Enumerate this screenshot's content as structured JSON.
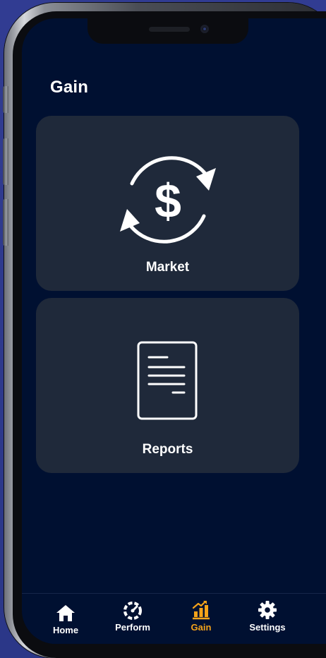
{
  "header": {
    "title": "Gain"
  },
  "cards": {
    "market": {
      "label": "Market",
      "icon": "dollar-exchange-icon"
    },
    "reports": {
      "label": "Reports",
      "icon": "document-icon"
    }
  },
  "tabbar": {
    "items": [
      {
        "label": "Home",
        "icon": "home-icon",
        "active": false
      },
      {
        "label": "Perform",
        "icon": "speedometer-icon",
        "active": false
      },
      {
        "label": "Gain",
        "icon": "bar-chart-icon",
        "active": true
      },
      {
        "label": "Settings",
        "icon": "gear-icon",
        "active": false
      }
    ]
  },
  "colors": {
    "background": "#001031",
    "card": "#1f293a",
    "accent": "#f5a31a",
    "text": "#ffffff"
  }
}
